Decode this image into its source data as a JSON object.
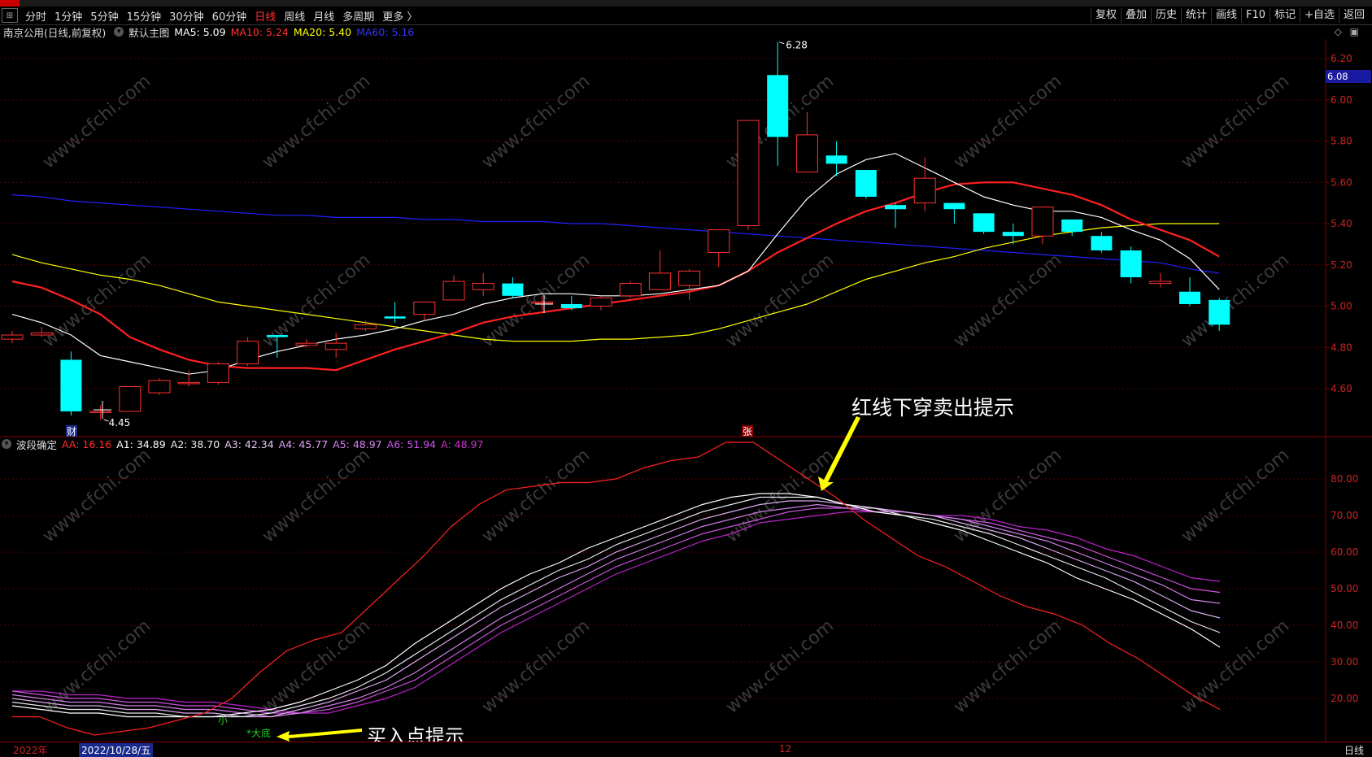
{
  "toolbar": {
    "grid_icon": "grid-icon",
    "periods": [
      "分时",
      "1分钟",
      "5分钟",
      "15分钟",
      "30分钟",
      "60分钟",
      "日线",
      "周线",
      "月线",
      "多周期",
      "更多 〉"
    ],
    "active_period": "日线",
    "right_buttons": [
      "复权",
      "叠加",
      "历史",
      "统计",
      "画线",
      "F10",
      "标记",
      "+自选",
      "返回"
    ]
  },
  "main_panel": {
    "title": "南京公用(日线,前复权)",
    "indicator": "默认主图",
    "ma5": "MA5: 5.09",
    "ma10": "MA10: 5.24",
    "ma20": "MA20: 5.40",
    "ma60": "MA60: 5.16",
    "high_label": "6.28",
    "low_label": "4.45",
    "current_price_tag": "6.08",
    "markers": {
      "cai": "财",
      "zhang": "张"
    },
    "y_axis": [
      "6.20",
      "6.00",
      "5.80",
      "5.60",
      "5.40",
      "5.20",
      "5.00",
      "4.80",
      "4.60"
    ]
  },
  "sub_panel": {
    "name": "波段确定",
    "aa": "AA: 16.16",
    "a1": "A1: 34.89",
    "a2": "A2: 38.70",
    "a3": "A3: 42.34",
    "a4": "A4: 45.77",
    "a5": "A5: 48.97",
    "a6": "A6: 51.94",
    "a": "A: 48.97",
    "y_axis": [
      "80.00",
      "70.00",
      "60.00",
      "50.00",
      "40.00",
      "30.00",
      "20.00"
    ],
    "marker_small": "小",
    "marker_big": "*大底"
  },
  "annotations": {
    "sell_hint": "红线下穿卖出提示",
    "buy_hint": "买入点提示"
  },
  "status_bar": {
    "year": "2022年",
    "date": "2022/10/28/五",
    "mid_mark": "12",
    "mode": "日线"
  },
  "watermark": "www.cfchi.com",
  "colors": {
    "up": "#ff3030",
    "down": "#00ffff",
    "ma5": "#ffffff",
    "ma10": "#ff2020",
    "ma20": "#ffff00",
    "ma60": "#2020ff",
    "aa": "#ff2020",
    "a1": "#ffffff",
    "a6": "#cc33cc",
    "annotation_arrow": "#ffff00"
  },
  "candles": [
    {
      "o": 4.84,
      "h": 4.88,
      "l": 4.82,
      "c": 4.86
    },
    {
      "o": 4.86,
      "h": 4.9,
      "l": 4.85,
      "c": 4.87
    },
    {
      "o": 4.74,
      "h": 4.78,
      "l": 4.47,
      "c": 4.49
    },
    {
      "o": 4.49,
      "h": 4.52,
      "l": 4.45,
      "c": 4.49
    },
    {
      "o": 4.49,
      "h": 4.6,
      "l": 4.49,
      "c": 4.61
    },
    {
      "o": 4.58,
      "h": 4.65,
      "l": 4.57,
      "c": 4.64
    },
    {
      "o": 4.63,
      "h": 4.69,
      "l": 4.61,
      "c": 4.63
    },
    {
      "o": 4.63,
      "h": 4.73,
      "l": 4.62,
      "c": 4.72
    },
    {
      "o": 4.72,
      "h": 4.85,
      "l": 4.71,
      "c": 4.83
    },
    {
      "o": 4.86,
      "h": 4.86,
      "l": 4.75,
      "c": 4.85
    },
    {
      "o": 4.81,
      "h": 4.84,
      "l": 4.8,
      "c": 4.82
    },
    {
      "o": 4.79,
      "h": 4.87,
      "l": 4.75,
      "c": 4.82
    },
    {
      "o": 4.89,
      "h": 4.93,
      "l": 4.88,
      "c": 4.91
    },
    {
      "o": 4.95,
      "h": 5.02,
      "l": 4.92,
      "c": 4.94
    },
    {
      "o": 4.96,
      "h": 5.02,
      "l": 4.93,
      "c": 5.02
    },
    {
      "o": 5.03,
      "h": 5.15,
      "l": 5.03,
      "c": 5.12
    },
    {
      "o": 5.08,
      "h": 5.16,
      "l": 5.05,
      "c": 5.11
    },
    {
      "o": 5.11,
      "h": 5.14,
      "l": 5.04,
      "c": 5.05
    },
    {
      "o": 5.02,
      "h": 5.05,
      "l": 4.98,
      "c": 5.02
    },
    {
      "o": 5.01,
      "h": 5.05,
      "l": 4.98,
      "c": 4.99
    },
    {
      "o": 5.0,
      "h": 5.05,
      "l": 4.98,
      "c": 5.04
    },
    {
      "o": 5.05,
      "h": 5.12,
      "l": 5.04,
      "c": 5.11
    },
    {
      "o": 5.08,
      "h": 5.27,
      "l": 5.08,
      "c": 5.16
    },
    {
      "o": 5.1,
      "h": 5.18,
      "l": 5.03,
      "c": 5.17
    },
    {
      "o": 5.26,
      "h": 5.37,
      "l": 5.19,
      "c": 5.37
    },
    {
      "o": 5.39,
      "h": 5.9,
      "l": 5.37,
      "c": 5.9
    },
    {
      "o": 6.12,
      "h": 6.28,
      "l": 5.68,
      "c": 5.82
    },
    {
      "o": 5.65,
      "h": 5.94,
      "l": 5.65,
      "c": 5.83
    },
    {
      "o": 5.73,
      "h": 5.8,
      "l": 5.63,
      "c": 5.69
    },
    {
      "o": 5.66,
      "h": 5.66,
      "l": 5.52,
      "c": 5.53
    },
    {
      "o": 5.49,
      "h": 5.5,
      "l": 5.38,
      "c": 5.47
    },
    {
      "o": 5.5,
      "h": 5.72,
      "l": 5.46,
      "c": 5.62
    },
    {
      "o": 5.5,
      "h": 5.5,
      "l": 5.4,
      "c": 5.47
    },
    {
      "o": 5.45,
      "h": 5.45,
      "l": 5.35,
      "c": 5.36
    },
    {
      "o": 5.36,
      "h": 5.4,
      "l": 5.3,
      "c": 5.34
    },
    {
      "o": 5.34,
      "h": 5.48,
      "l": 5.3,
      "c": 5.48
    },
    {
      "o": 5.42,
      "h": 5.42,
      "l": 5.34,
      "c": 5.36
    },
    {
      "o": 5.34,
      "h": 5.36,
      "l": 5.26,
      "c": 5.27
    },
    {
      "o": 5.27,
      "h": 5.29,
      "l": 5.11,
      "c": 5.14
    },
    {
      "o": 5.11,
      "h": 5.16,
      "l": 5.09,
      "c": 5.12
    },
    {
      "o": 5.07,
      "h": 5.14,
      "l": 5.0,
      "c": 5.01
    },
    {
      "o": 5.03,
      "h": 5.04,
      "l": 4.88,
      "c": 4.91
    }
  ],
  "ma_lines": {
    "ma5": [
      4.96,
      4.92,
      4.86,
      4.76,
      4.73,
      4.7,
      4.67,
      4.69,
      4.74,
      4.78,
      4.81,
      4.84,
      4.86,
      4.89,
      4.93,
      4.96,
      5.01,
      5.04,
      5.06,
      5.06,
      5.05,
      5.05,
      5.06,
      5.08,
      5.1,
      5.17,
      5.35,
      5.52,
      5.64,
      5.71,
      5.74,
      5.67,
      5.6,
      5.53,
      5.49,
      5.46,
      5.46,
      5.43,
      5.37,
      5.32,
      5.23,
      5.08
    ],
    "ma10": [
      5.12,
      5.09,
      5.03,
      4.96,
      4.85,
      4.79,
      4.74,
      4.71,
      4.7,
      4.7,
      4.7,
      4.69,
      4.74,
      4.79,
      4.83,
      4.87,
      4.92,
      4.95,
      4.97,
      4.99,
      5.01,
      5.03,
      5.05,
      5.07,
      5.1,
      5.17,
      5.26,
      5.33,
      5.4,
      5.46,
      5.5,
      5.55,
      5.59,
      5.6,
      5.6,
      5.57,
      5.54,
      5.49,
      5.42,
      5.37,
      5.32,
      5.24
    ],
    "ma20": [
      5.25,
      5.21,
      5.18,
      5.15,
      5.13,
      5.1,
      5.06,
      5.02,
      5.0,
      4.98,
      4.96,
      4.94,
      4.92,
      4.9,
      4.88,
      4.86,
      4.84,
      4.83,
      4.83,
      4.83,
      4.84,
      4.84,
      4.85,
      4.86,
      4.89,
      4.93,
      4.97,
      5.01,
      5.07,
      5.13,
      5.17,
      5.21,
      5.24,
      5.28,
      5.31,
      5.34,
      5.36,
      5.38,
      5.39,
      5.4,
      5.4,
      5.4
    ],
    "ma60": [
      5.54,
      5.53,
      5.51,
      5.5,
      5.49,
      5.48,
      5.47,
      5.46,
      5.45,
      5.44,
      5.44,
      5.43,
      5.43,
      5.43,
      5.42,
      5.42,
      5.41,
      5.41,
      5.41,
      5.4,
      5.4,
      5.39,
      5.38,
      5.37,
      5.36,
      5.35,
      5.34,
      5.33,
      5.32,
      5.31,
      5.3,
      5.29,
      5.28,
      5.27,
      5.26,
      5.25,
      5.24,
      5.23,
      5.22,
      5.21,
      5.18,
      5.16
    ]
  },
  "indicator_lines": {
    "aa": [
      15,
      15,
      12,
      10,
      11,
      12,
      14,
      16,
      20,
      27,
      33,
      36,
      38,
      45,
      52,
      59,
      67,
      73,
      77,
      78,
      79,
      79,
      80,
      83,
      85,
      86,
      90,
      90,
      85,
      80,
      75,
      69,
      64,
      59,
      56,
      52,
      48,
      45,
      43,
      40,
      35,
      31,
      26,
      21,
      17
    ],
    "a1": [
      18,
      17,
      16,
      16,
      15,
      15,
      15,
      15,
      16,
      17,
      19,
      22,
      25,
      29,
      35,
      40,
      45,
      50,
      54,
      57,
      61,
      64,
      67,
      70,
      73,
      75,
      76,
      76,
      75,
      73,
      71,
      70,
      68,
      66,
      63,
      60,
      57,
      53,
      50,
      47,
      43,
      39,
      34
    ],
    "a2": [
      19,
      18,
      17,
      17,
      16,
      16,
      15,
      15,
      15,
      16,
      18,
      20,
      23,
      27,
      32,
      37,
      42,
      47,
      51,
      55,
      58,
      62,
      65,
      68,
      71,
      73,
      75,
      75,
      75,
      73,
      72,
      70,
      69,
      67,
      65,
      62,
      59,
      56,
      53,
      49,
      45,
      41,
      38
    ],
    "a3": [
      20,
      19,
      18,
      18,
      17,
      17,
      16,
      16,
      15,
      15,
      17,
      19,
      22,
      25,
      30,
      35,
      40,
      45,
      49,
      53,
      56,
      60,
      63,
      66,
      69,
      71,
      73,
      74,
      74,
      73,
      72,
      71,
      70,
      68,
      66,
      64,
      61,
      58,
      55,
      52,
      48,
      44,
      42
    ],
    "a4": [
      21,
      20,
      19,
      19,
      18,
      18,
      17,
      17,
      16,
      15,
      16,
      18,
      20,
      23,
      27,
      32,
      37,
      42,
      46,
      50,
      54,
      58,
      61,
      64,
      67,
      69,
      71,
      72,
      73,
      72,
      72,
      71,
      70,
      69,
      67,
      65,
      63,
      60,
      57,
      54,
      51,
      47,
      46
    ],
    "a5": [
      22,
      21,
      20,
      20,
      19,
      19,
      18,
      18,
      17,
      16,
      16,
      17,
      19,
      22,
      25,
      30,
      35,
      40,
      44,
      48,
      52,
      56,
      59,
      62,
      65,
      67,
      69,
      71,
      72,
      72,
      71,
      71,
      70,
      69,
      68,
      66,
      64,
      62,
      59,
      56,
      53,
      50,
      49
    ],
    "a6": [
      22,
      22,
      21,
      21,
      20,
      20,
      19,
      19,
      18,
      17,
      16,
      16,
      18,
      20,
      23,
      28,
      33,
      38,
      42,
      46,
      50,
      54,
      57,
      60,
      63,
      65,
      68,
      69,
      70,
      71,
      71,
      71,
      70,
      70,
      69,
      67,
      66,
      64,
      61,
      59,
      56,
      53,
      52
    ]
  }
}
